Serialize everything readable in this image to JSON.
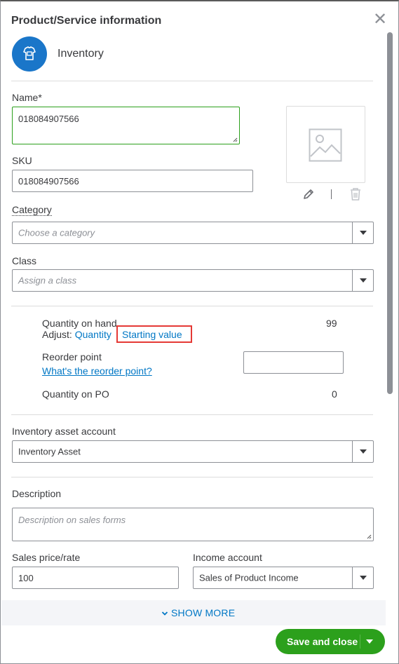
{
  "dialog": {
    "title": "Product/Service information",
    "type_label": "Inventory"
  },
  "fields": {
    "name_label": "Name*",
    "name_value": "018084907566",
    "sku_label": "SKU",
    "sku_value": "018084907566",
    "category_label": "Category",
    "category_placeholder": "Choose a category",
    "class_label": "Class",
    "class_placeholder": "Assign a class"
  },
  "quantity": {
    "on_hand_label": "Quantity on hand",
    "on_hand_value": "99",
    "adjust_label": "Adjust:",
    "adjust_quantity_link": "Quantity",
    "adjust_starting_value_link": "Starting value",
    "reorder_label": "Reorder point",
    "reorder_help_link": "What's the reorder point?",
    "reorder_value": "",
    "on_po_label": "Quantity on PO",
    "on_po_value": "0"
  },
  "accounts": {
    "asset_label": "Inventory asset account",
    "asset_value": "Inventory Asset",
    "description_label": "Description",
    "description_placeholder": "Description on sales forms",
    "sales_price_label": "Sales price/rate",
    "sales_price_value": "100",
    "income_label": "Income account",
    "income_value": "Sales of Product Income"
  },
  "footer": {
    "show_more_label": "SHOW MORE",
    "save_label": "Save and close"
  },
  "icons": {
    "close": "close-icon",
    "product_type": "tshirt-tag-icon",
    "image_placeholder": "image-placeholder-icon",
    "edit": "pencil-icon",
    "delete": "trash-icon",
    "dropdown": "chevron-down-icon"
  },
  "colors": {
    "brand_blue": "#1a76c9",
    "link_blue": "#0077c5",
    "green": "#2ca01c",
    "highlight_red": "#e53935"
  }
}
